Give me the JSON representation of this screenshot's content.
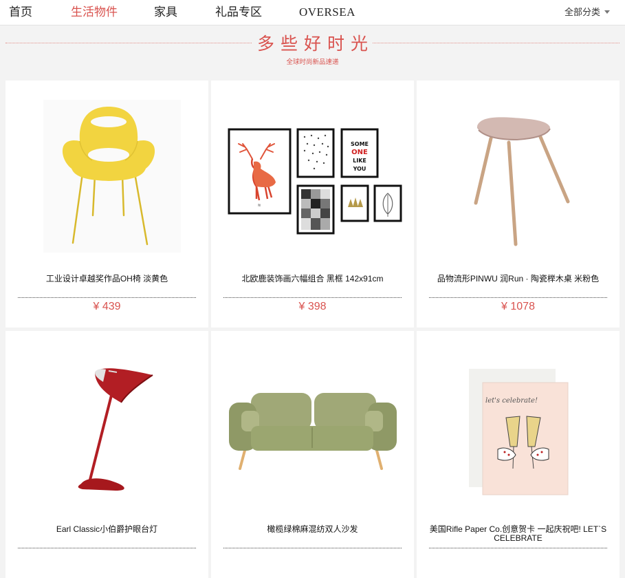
{
  "nav": {
    "items": [
      {
        "label": "首页",
        "active": false
      },
      {
        "label": "生活物件",
        "active": true
      },
      {
        "label": "家具",
        "active": false
      },
      {
        "label": "礼品专区",
        "active": false
      },
      {
        "label": "OVERSEA",
        "active": false
      }
    ],
    "category_dropdown": "全部分类"
  },
  "banner": {
    "title": "多些好时光",
    "subtitle": "全球时尚新品速递"
  },
  "products": [
    {
      "name": "工业设计卓越奖作品OH椅 淡黄色",
      "price": "¥ 439",
      "icon": "yellow-chair"
    },
    {
      "name": "北欧鹿装饰画六幅组合 黑框 142x91cm",
      "price": "¥ 398",
      "icon": "deer-frames"
    },
    {
      "name": "品物流形PINWU 润Run · 陶瓷榉木桌 米粉色",
      "price": "¥ 1078",
      "icon": "ceramic-stool"
    },
    {
      "name": "Earl Classic小伯爵护眼台灯",
      "price": "",
      "icon": "red-lamp"
    },
    {
      "name": "橄榄绿棉麻混纺双人沙发",
      "price": "",
      "icon": "green-sofa"
    },
    {
      "name": "美国Rifle Paper Co.创意贺卡 一起庆祝吧! LET`S CELEBRATE",
      "price": "",
      "icon": "celebrate-card"
    }
  ],
  "images": {
    "poster_text": [
      "SOME",
      "ONE",
      "LIKE",
      "YOU"
    ],
    "card_script": "let's celebrate!"
  },
  "colors": {
    "accent": "#d9534f",
    "background": "#f3f3f3",
    "chair": "#f2d440",
    "lamp": "#b21e24",
    "sofa": "#9aa471"
  }
}
